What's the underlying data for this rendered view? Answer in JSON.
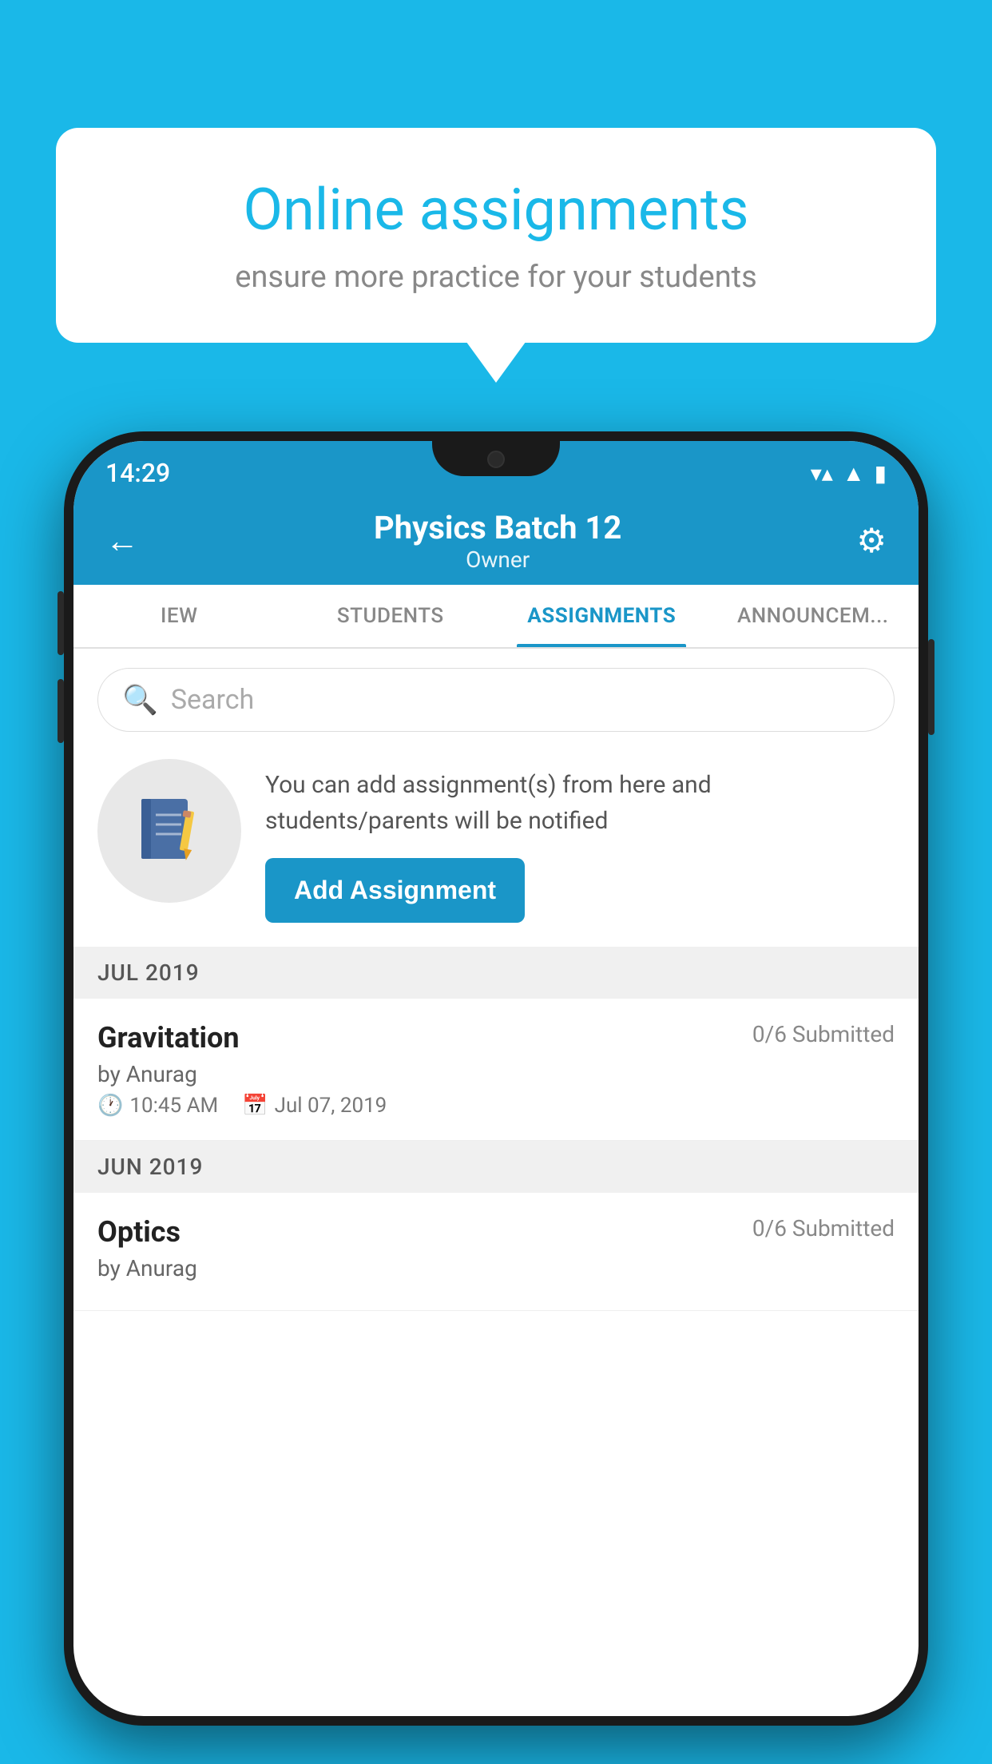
{
  "background_color": "#1ab8e8",
  "speech_bubble": {
    "title": "Online assignments",
    "subtitle": "ensure more practice for your students"
  },
  "status_bar": {
    "time": "14:29",
    "wifi_icon": "▼",
    "signal_icon": "▲",
    "battery_icon": "▮"
  },
  "header": {
    "title": "Physics Batch 12",
    "subtitle": "Owner",
    "back_label": "←",
    "settings_label": "⚙"
  },
  "tabs": [
    {
      "label": "IEW",
      "active": false
    },
    {
      "label": "STUDENTS",
      "active": false
    },
    {
      "label": "ASSIGNMENTS",
      "active": true
    },
    {
      "label": "ANNOUNCEM...",
      "active": false
    }
  ],
  "search": {
    "placeholder": "Search"
  },
  "info_card": {
    "text": "You can add assignment(s) from here and students/parents will be notified",
    "button_label": "Add Assignment"
  },
  "sections": [
    {
      "month": "JUL 2019",
      "assignments": [
        {
          "name": "Gravitation",
          "submitted": "0/6 Submitted",
          "author": "by Anurag",
          "time": "10:45 AM",
          "date": "Jul 07, 2019"
        }
      ]
    },
    {
      "month": "JUN 2019",
      "assignments": [
        {
          "name": "Optics",
          "submitted": "0/6 Submitted",
          "author": "by Anurag",
          "time": "",
          "date": ""
        }
      ]
    }
  ]
}
